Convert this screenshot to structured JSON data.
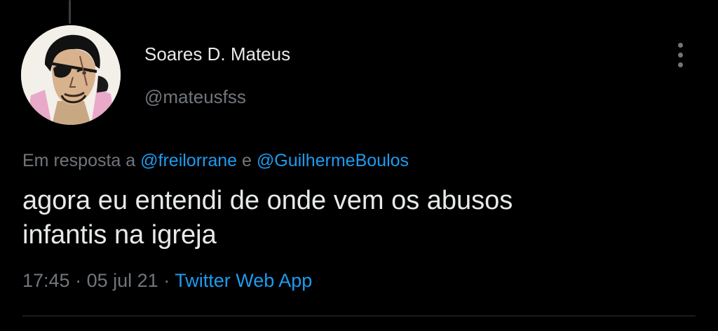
{
  "tweet": {
    "author": {
      "display_name": "Soares D. Mateus",
      "handle": "@mateusfss",
      "avatar_icon": "avatar-image"
    },
    "reply_context": {
      "prefix": "Em resposta a",
      "mentions": [
        "@freilorrane",
        "@GuilhermeBoulos"
      ],
      "joiner": "e"
    },
    "text_lines": [
      "agora eu entendi de onde vem os abusos",
      "infantis na igreja"
    ],
    "meta": {
      "time": "17:45",
      "separator": "·",
      "date": "05 jul 21",
      "source": "Twitter Web App"
    },
    "menu_icon": "more-vertical-icon"
  },
  "colors": {
    "background": "#000000",
    "primary_text": "#e7e9ea",
    "secondary_text": "#71767b",
    "link": "#1d9bf0",
    "divider": "#2f3336"
  }
}
